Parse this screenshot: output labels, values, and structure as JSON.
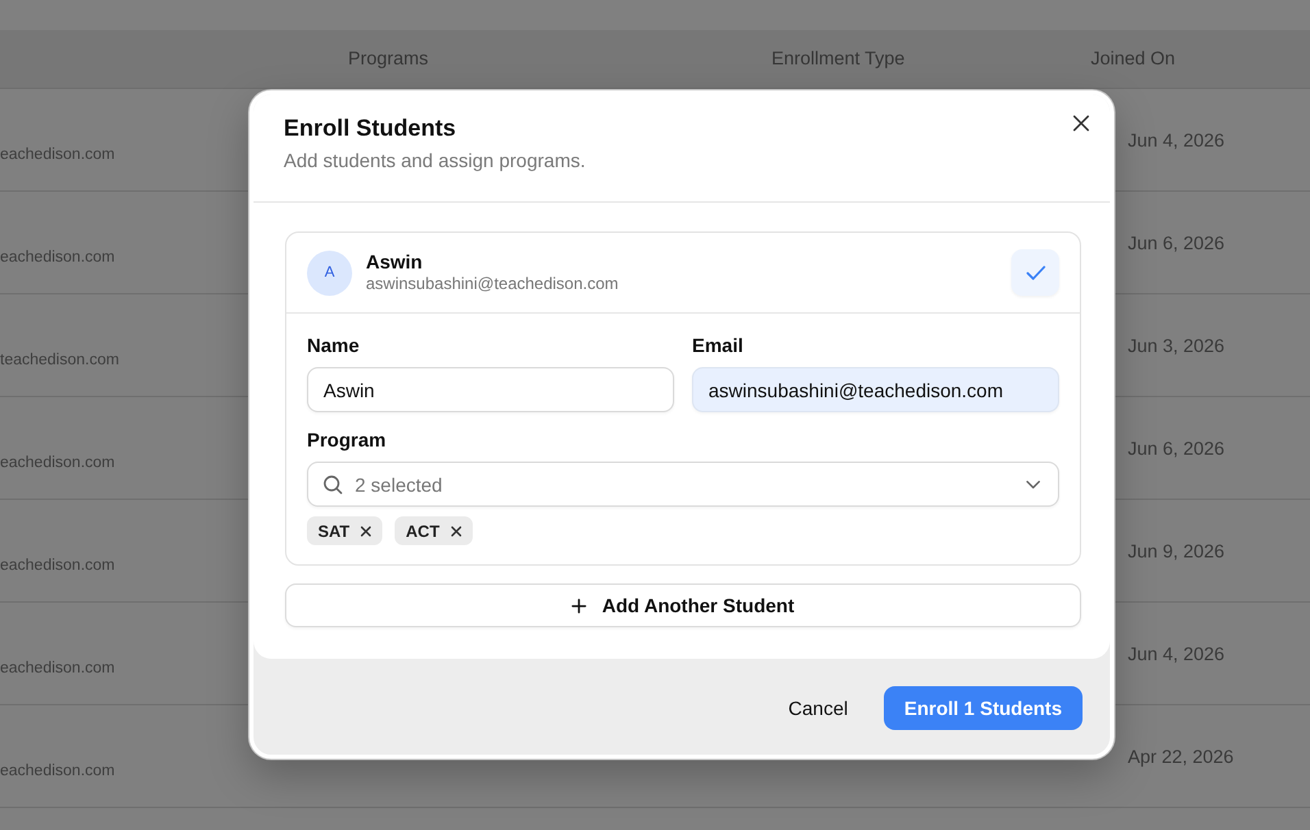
{
  "table": {
    "columns": [
      {
        "label": "Programs"
      },
      {
        "label": "Enrollment Type"
      },
      {
        "label": "Joined On"
      }
    ],
    "rows": [
      {
        "email": "eachedison.com",
        "joined_on": "Jun 4, 2026"
      },
      {
        "email": "eachedison.com",
        "joined_on": "Jun 6, 2026"
      },
      {
        "email": "teachedison.com",
        "joined_on": "Jun 3, 2026"
      },
      {
        "email": "eachedison.com",
        "joined_on": "Jun 6, 2026"
      },
      {
        "email": "eachedison.com",
        "joined_on": "Jun 9, 2026"
      },
      {
        "email": "eachedison.com",
        "joined_on": "Jun 4, 2026"
      },
      {
        "email": "eachedison.com",
        "joined_on": "Apr 22, 2026"
      }
    ]
  },
  "dialog": {
    "title": "Enroll Students",
    "subtitle": "Add students and assign programs.",
    "students": [
      {
        "initial": "A",
        "name": "Aswin",
        "email": "aswinsubashini@teachedison.com",
        "confirmed": true,
        "fields": [
          {
            "label": "Name",
            "value": "Aswin",
            "autofilled": false
          },
          {
            "label": "Email",
            "value": "aswinsubashini@teachedison.com",
            "autofilled": true
          }
        ],
        "program": {
          "label": "Program",
          "placeholder": "2 selected",
          "tags": [
            {
              "label": "SAT"
            },
            {
              "label": "ACT"
            }
          ]
        }
      }
    ],
    "add_button": "Add Another Student",
    "cancel_button": "Cancel",
    "submit_button": "Enroll 1 Students"
  }
}
